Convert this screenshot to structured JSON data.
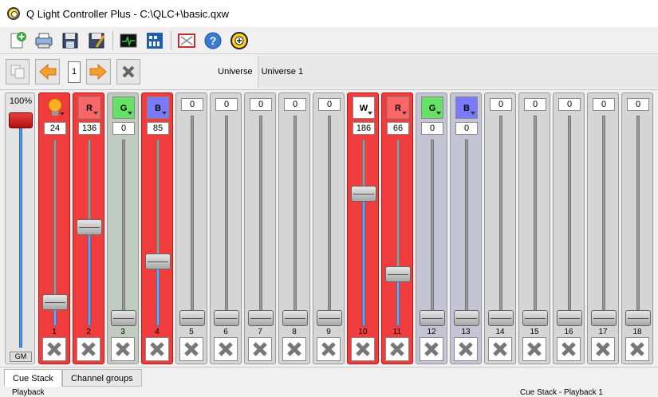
{
  "window": {
    "title": "Q Light Controller Plus - C:\\QLC+\\basic.qxw"
  },
  "toolbar": {
    "items": [
      "new-icon",
      "open-icon",
      "save-icon",
      "save-as-icon",
      "monitor-icon",
      "address-tool-icon",
      "fullscreen-icon",
      "help-icon",
      "about-icon"
    ]
  },
  "subbar": {
    "page": "1",
    "universe_label": "Universe",
    "universe_value": "Universe 1"
  },
  "grand_master": {
    "value_label": "100%",
    "button_label": "GM",
    "level": 1.0
  },
  "channels": [
    {
      "num": "1",
      "value": "24",
      "icon": "bulb",
      "label": "",
      "bg": "red",
      "level": 0.094
    },
    {
      "num": "2",
      "value": "136",
      "icon": "r",
      "label": "R",
      "bg": "red",
      "level": 0.533
    },
    {
      "num": "3",
      "value": "0",
      "icon": "g",
      "label": "G",
      "bg": "green",
      "level": 0
    },
    {
      "num": "4",
      "value": "85",
      "icon": "b",
      "label": "B",
      "bg": "red",
      "level": 0.333
    },
    {
      "num": "5",
      "value": "0",
      "icon": "plain",
      "label": "0",
      "bg": "plain",
      "level": 0
    },
    {
      "num": "6",
      "value": "0",
      "icon": "plain",
      "label": "0",
      "bg": "plain",
      "level": 0
    },
    {
      "num": "7",
      "value": "0",
      "icon": "plain",
      "label": "0",
      "bg": "plain",
      "level": 0
    },
    {
      "num": "8",
      "value": "0",
      "icon": "plain",
      "label": "0",
      "bg": "plain",
      "level": 0
    },
    {
      "num": "9",
      "value": "0",
      "icon": "plain",
      "label": "0",
      "bg": "plain",
      "level": 0
    },
    {
      "num": "10",
      "value": "186",
      "icon": "w",
      "label": "W",
      "bg": "red",
      "level": 0.729
    },
    {
      "num": "11",
      "value": "66",
      "icon": "r",
      "label": "R",
      "bg": "red",
      "level": 0.259
    },
    {
      "num": "12",
      "value": "0",
      "icon": "g",
      "label": "G",
      "bg": "blue",
      "level": 0
    },
    {
      "num": "13",
      "value": "0",
      "icon": "b",
      "label": "B",
      "bg": "blue",
      "level": 0
    },
    {
      "num": "14",
      "value": "0",
      "icon": "plain",
      "label": "0",
      "bg": "plain",
      "level": 0
    },
    {
      "num": "15",
      "value": "0",
      "icon": "plain",
      "label": "0",
      "bg": "plain",
      "level": 0
    },
    {
      "num": "16",
      "value": "0",
      "icon": "plain",
      "label": "0",
      "bg": "plain",
      "level": 0
    },
    {
      "num": "17",
      "value": "0",
      "icon": "plain",
      "label": "0",
      "bg": "plain",
      "level": 0
    },
    {
      "num": "18",
      "value": "0",
      "icon": "plain",
      "label": "0",
      "bg": "plain",
      "level": 0
    }
  ],
  "tabs": [
    {
      "label": "Cue Stack",
      "active": true
    },
    {
      "label": "Channel groups",
      "active": false
    }
  ],
  "status": {
    "left": "Playback",
    "right": "Cue Stack - Playback 1"
  }
}
